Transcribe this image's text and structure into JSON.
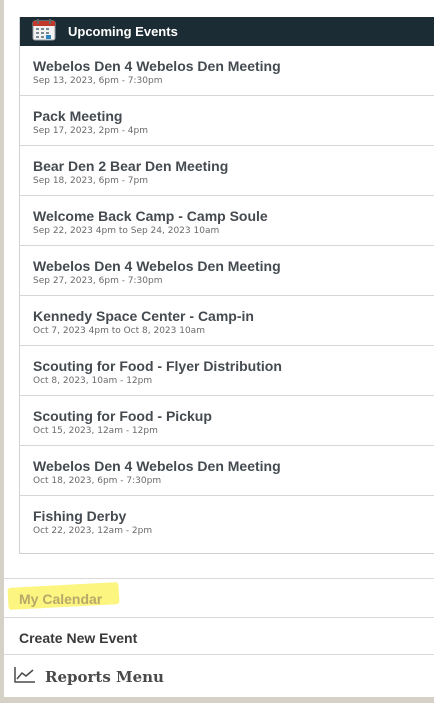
{
  "upcoming_events": {
    "title": "Upcoming Events",
    "events": [
      {
        "title": "Webelos Den 4 Webelos Den Meeting",
        "date": "Sep 13, 2023, 6pm - 7:30pm"
      },
      {
        "title": "Pack Meeting",
        "date": "Sep 17, 2023, 2pm - 4pm"
      },
      {
        "title": "Bear Den 2 Bear Den Meeting",
        "date": "Sep 18, 2023, 6pm - 7pm"
      },
      {
        "title": "Welcome Back Camp - Camp Soule",
        "date": "Sep 22, 2023 4pm to Sep 24, 2023 10am"
      },
      {
        "title": "Webelos Den 4 Webelos Den Meeting",
        "date": "Sep 27, 2023, 6pm - 7:30pm"
      },
      {
        "title": "Kennedy Space Center - Camp-in",
        "date": "Oct 7, 2023 4pm to Oct 8, 2023 10am"
      },
      {
        "title": "Scouting for Food - Flyer Distribution",
        "date": "Oct 8, 2023, 10am - 12pm"
      },
      {
        "title": "Scouting for Food - Pickup",
        "date": "Oct 15, 2023, 12am - 12pm"
      },
      {
        "title": "Webelos Den 4 Webelos Den Meeting",
        "date": "Oct 18, 2023, 6pm - 7:30pm"
      },
      {
        "title": "Fishing Derby",
        "date": "Oct 22, 2023, 12am - 2pm"
      }
    ]
  },
  "menu": {
    "my_calendar": "My Calendar",
    "create_event": "Create New Event",
    "reports": "Reports Menu"
  },
  "icons": {
    "header": "calendar-icon",
    "reports": "line-chart-icon"
  },
  "colors": {
    "header_bg": "#1c2c34",
    "highlight": "#fbf36a",
    "my_calendar_text": "#b9a86a"
  }
}
